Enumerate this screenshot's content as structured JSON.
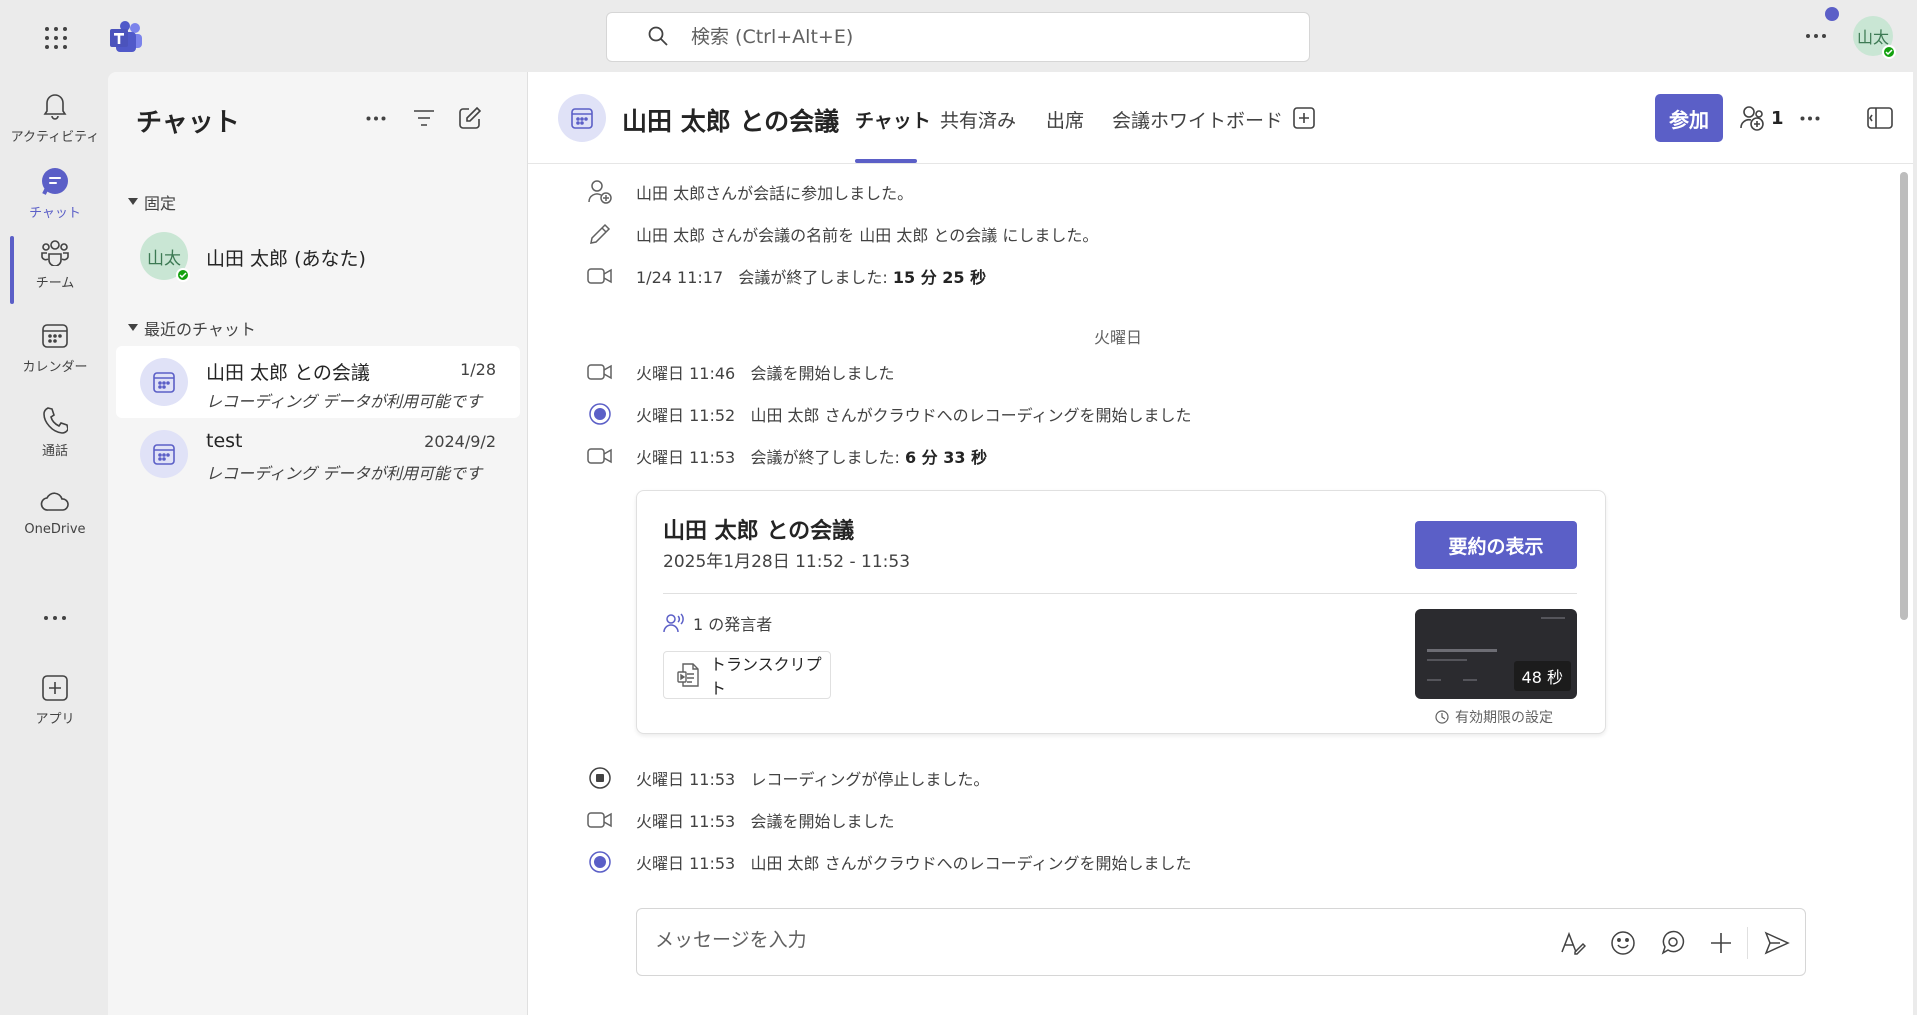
{
  "app": {
    "accent": "#5b5fc7",
    "search_placeholder": "検索 (Ctrl+Alt+E)",
    "me_initials": "山太"
  },
  "rail": [
    {
      "label": "アクティビティ",
      "icon": "bell-icon"
    },
    {
      "label": "チャット",
      "icon": "chat-icon"
    },
    {
      "label": "チーム",
      "icon": "teams-icon"
    },
    {
      "label": "カレンダー",
      "icon": "calendar-icon"
    },
    {
      "label": "通話",
      "icon": "phone-icon"
    },
    {
      "label": "OneDrive",
      "icon": "cloud-icon"
    },
    {
      "label": "アプリ",
      "icon": "add-app-icon"
    }
  ],
  "chat_panel": {
    "title": "チャット",
    "pinned_label": "固定",
    "pinned": [
      {
        "initials": "山太",
        "name": "山田 太郎 (あなた)"
      }
    ],
    "recent_label": "最近のチャット",
    "recent": [
      {
        "name": "山田 太郎 との会議",
        "date": "1/28",
        "preview": "レコーディング データが利用可能です"
      },
      {
        "name": "test",
        "date": "2024/9/2",
        "preview": "レコーディング データが利用可能です"
      }
    ]
  },
  "header": {
    "title": "山田 太郎 との会議",
    "tabs": [
      "チャット",
      "共有済み",
      "出席",
      "会議ホワイトボード"
    ],
    "join_label": "参加",
    "participant_count": "1"
  },
  "events": [
    {
      "text": "山田 太郎さんが会話に参加しました。"
    },
    {
      "text": "山田 太郎 さんが会議の名前を 山田 太郎 との会議 にしました。"
    },
    {
      "time": "1/24 11:17",
      "text": "会議が終了しました:",
      "bold": "15 分 25 秒"
    },
    {
      "time": "火曜日 11:46",
      "text": "会議を開始しました"
    },
    {
      "time": "火曜日 11:52",
      "text": "山田 太郎 さんがクラウドへのレコーディングを開始しました"
    },
    {
      "time": "火曜日 11:53",
      "text": "会議が終了しました:",
      "bold": "6 分 33 秒"
    },
    {
      "time": "火曜日 11:53",
      "text": "レコーディングが停止しました。"
    },
    {
      "time": "火曜日 11:53",
      "text": "会議を開始しました"
    },
    {
      "time": "火曜日 11:53",
      "text": "山田 太郎 さんがクラウドへのレコーディングを開始しました"
    }
  ],
  "day_divider": "火曜日",
  "card": {
    "title": "山田 太郎 との会議",
    "time": "2025年1月28日 11:52 - 11:53",
    "summary_button": "要約の表示",
    "speakers": "1 の発言者",
    "transcript": "トランスクリプト",
    "duration": "48 秒",
    "expiry": "有効期限の設定"
  },
  "composer": {
    "placeholder": "メッセージを入力"
  }
}
